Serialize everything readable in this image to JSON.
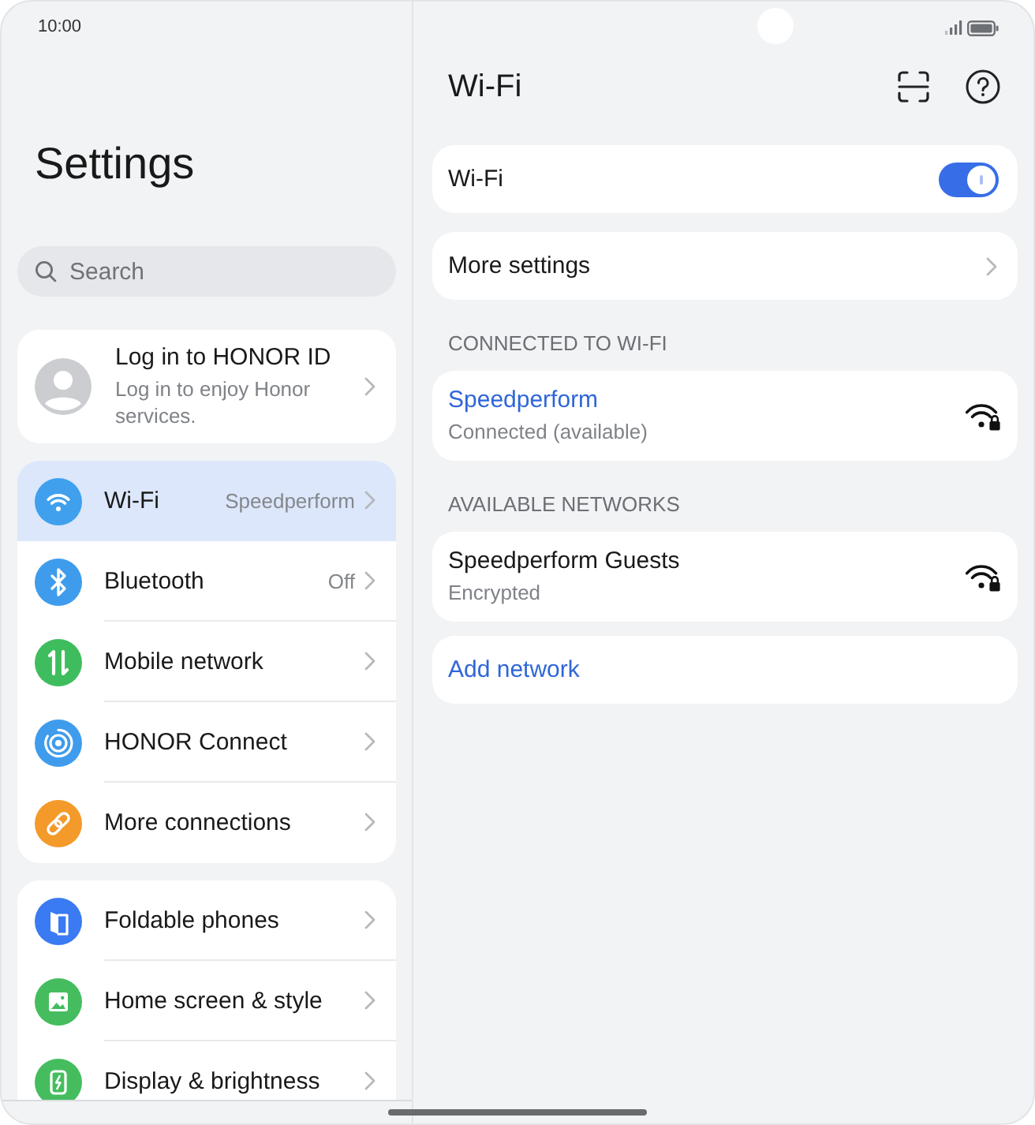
{
  "status_bar": {
    "time": "10:00"
  },
  "settings_panel": {
    "title": "Settings",
    "search": {
      "placeholder": "Search"
    },
    "account": {
      "title": "Log in to HONOR ID",
      "subtitle": "Log in to enjoy Honor services."
    },
    "groups": [
      {
        "items": [
          {
            "label": "Wi-Fi",
            "value": "Speedperform",
            "selected": true,
            "color": "#40a0ee"
          },
          {
            "label": "Bluetooth",
            "value": "Off",
            "selected": false,
            "color": "#3f9cec"
          },
          {
            "label": "Mobile network",
            "selected": false,
            "color": "#3fbd5e"
          },
          {
            "label": "HONOR Connect",
            "selected": false,
            "color": "#3f9cec"
          },
          {
            "label": "More connections",
            "selected": false,
            "color": "#f39a2a"
          }
        ]
      },
      {
        "items": [
          {
            "label": "Foldable phones",
            "selected": false,
            "color": "#3a7af2"
          },
          {
            "label": "Home screen & style",
            "selected": false,
            "color": "#45bd5f"
          },
          {
            "label": "Display & brightness",
            "selected": false,
            "color": "#45bd5f"
          }
        ]
      }
    ]
  },
  "wifi_panel": {
    "title": "Wi-Fi",
    "toggle": {
      "label": "Wi-Fi",
      "on": true
    },
    "more_settings": {
      "label": "More settings"
    },
    "sections": [
      {
        "heading": "CONNECTED TO WI-FI",
        "networks": [
          {
            "name": "Speedperform",
            "status": "Connected (available)",
            "connected": true
          }
        ]
      },
      {
        "heading": "AVAILABLE NETWORKS",
        "networks": [
          {
            "name": "Speedperform Guests",
            "status": "Encrypted",
            "connected": false
          }
        ]
      }
    ],
    "add_network": {
      "label": "Add network"
    }
  }
}
